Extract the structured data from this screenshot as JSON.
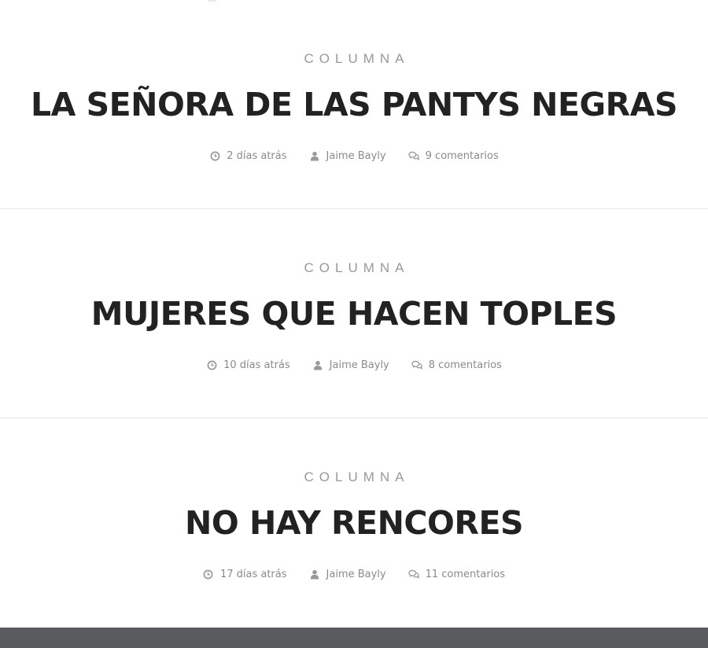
{
  "posts": [
    {
      "category": "COLUMNA",
      "title": "LA SEÑORA DE LAS PANTYS NEGRAS",
      "time": "2 días atrás",
      "author": "Jaime Bayly",
      "comments": "9 comentarios"
    },
    {
      "category": "COLUMNA",
      "title": "MUJERES QUE HACEN TOPLES",
      "time": "10 días atrás",
      "author": "Jaime Bayly",
      "comments": "8 comentarios"
    },
    {
      "category": "COLUMNA",
      "title": "NO HAY RENCORES",
      "time": "17 días atrás",
      "author": "Jaime Bayly",
      "comments": "11 comentarios"
    }
  ],
  "icons": {
    "time": "clock-icon",
    "author": "user-icon",
    "comments": "comments-icon"
  },
  "colors": {
    "title": "#222222",
    "category": "#999999",
    "meta": "#8a8a8a",
    "divider": "#e6e6e6",
    "footer": "#595b5e"
  }
}
